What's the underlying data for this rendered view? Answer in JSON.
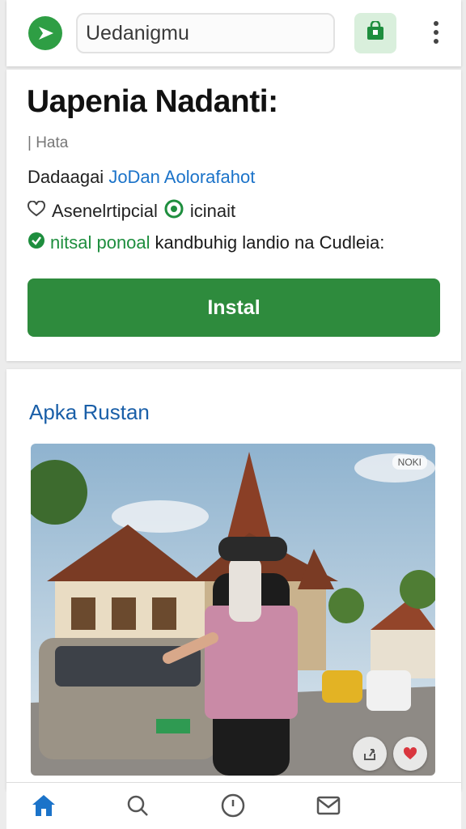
{
  "search": {
    "value": "Uedanigmu"
  },
  "app": {
    "title": "Uapenia Nadanti:",
    "subtitle": "| Hata",
    "developer_prefix": "Dadaagai",
    "developer_link": "JoDan Aolorafahot",
    "rating_text": "Asenelrtipcial",
    "rating_suffix": "icinait",
    "verified_prefix": "nitsal ponoal",
    "verified_rest": "kandbuhig landio na Cudleia:",
    "install_label": "Instal"
  },
  "section": {
    "title": "Apka Rustan",
    "photo_badge": "NOKI"
  },
  "icons": {
    "logo": "play-store-logo-icon",
    "store": "store-bag-icon",
    "menu": "kebab-menu-icon",
    "heart": "heart-outline-icon",
    "badge": "green-circle-icon",
    "check": "check-circle-icon",
    "share": "share-icon",
    "like": "heart-filled-icon",
    "nav": [
      "home-icon",
      "search-icon",
      "clock-icon",
      "mail-icon"
    ]
  },
  "colors": {
    "accent_green": "#2e8b3d",
    "link_blue": "#1b73c9",
    "section_blue": "#1a5fa8",
    "like_red": "#d9363e"
  }
}
